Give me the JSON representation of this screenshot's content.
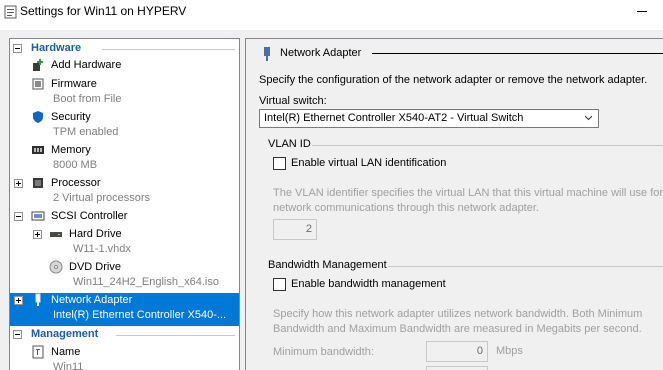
{
  "window": {
    "title": "Settings for Win11 on HYPERV"
  },
  "tree": {
    "hardware_header": "Hardware",
    "management_header": "Management",
    "items": [
      {
        "label": "Add Hardware",
        "sub": ""
      },
      {
        "label": "Firmware",
        "sub": "Boot from File"
      },
      {
        "label": "Security",
        "sub": "TPM enabled"
      },
      {
        "label": "Memory",
        "sub": "8000 MB"
      },
      {
        "label": "Processor",
        "sub": "2 Virtual processors"
      },
      {
        "label": "SCSI Controller",
        "sub": ""
      },
      {
        "label": "Hard Drive",
        "sub": "W11-1.vhdx"
      },
      {
        "label": "DVD Drive",
        "sub": "Win11_24H2_English_x64.iso"
      },
      {
        "label": "Network Adapter",
        "sub": "Intel(R) Ethernet Controller X540-..."
      },
      {
        "label": "Name",
        "sub": "Win11"
      }
    ]
  },
  "panel": {
    "title": "Network Adapter",
    "description": "Specify the configuration of the network adapter or remove the network adapter.",
    "virtual_switch_label": "Virtual switch:",
    "virtual_switch_value": "Intel(R) Ethernet Controller X540-AT2 - Virtual Switch",
    "vlan": {
      "title": "VLAN ID",
      "checkbox_label": "Enable virtual LAN identification",
      "help_line1": "The VLAN identifier specifies the virtual LAN that this virtual machine will use for a",
      "help_line2": "network communications through this network adapter.",
      "value": "2"
    },
    "bandwidth": {
      "title": "Bandwidth Management",
      "checkbox_label": "Enable bandwidth management",
      "help_line1": "Specify how this network adapter utilizes network bandwidth. Both Minimum",
      "help_line2": "Bandwidth and Maximum Bandwidth are measured in Megabits per second.",
      "min_label": "Minimum bandwidth:",
      "min_value": "0",
      "min_unit": "Mbps"
    }
  },
  "colors": {
    "selection": "#0078d7",
    "section_header": "#1e5ca8"
  }
}
